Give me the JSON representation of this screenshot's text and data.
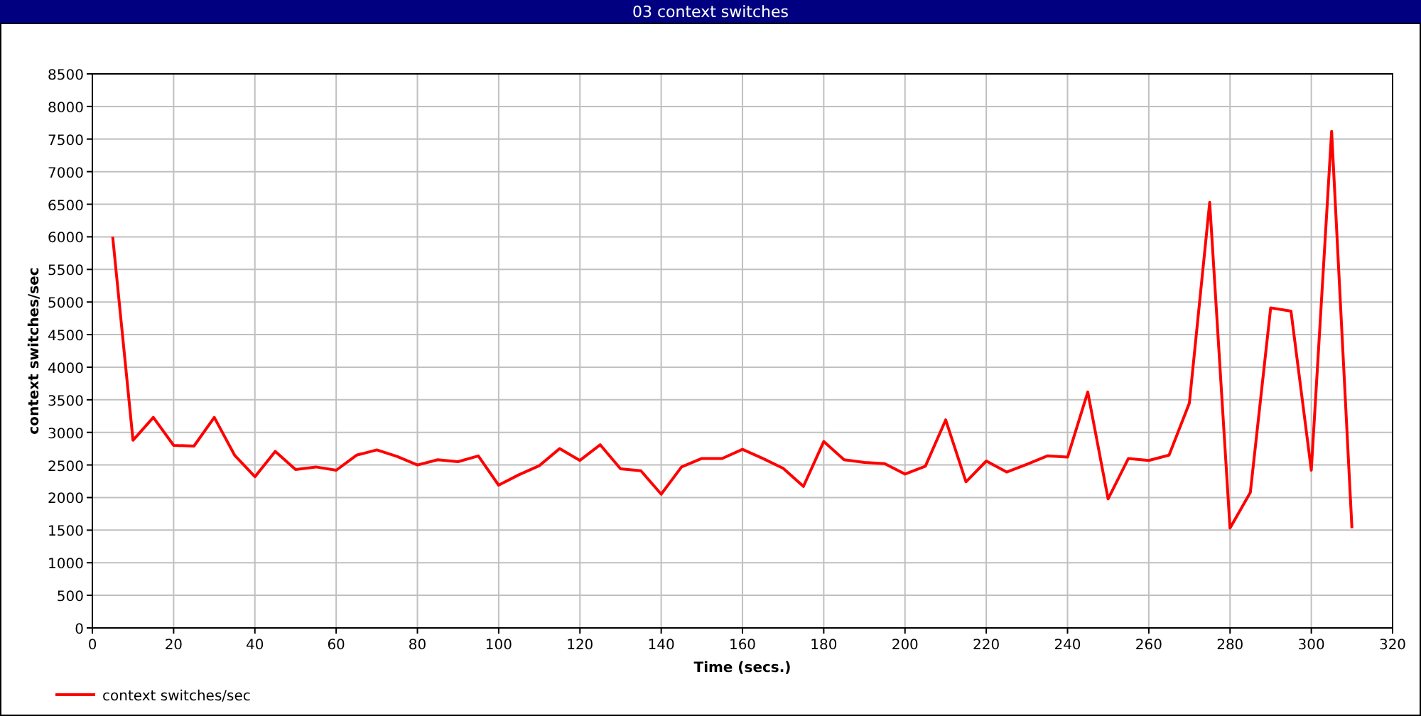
{
  "window": {
    "title": "03 context switches"
  },
  "chart": {
    "chart_data": {
      "type": "line",
      "xlabel": "Time (secs.)",
      "ylabel": "context switches/sec",
      "x": [
        5,
        10,
        15,
        20,
        25,
        30,
        35,
        40,
        45,
        50,
        55,
        60,
        65,
        70,
        75,
        80,
        85,
        90,
        95,
        100,
        105,
        110,
        115,
        120,
        125,
        130,
        135,
        140,
        145,
        150,
        155,
        160,
        165,
        170,
        175,
        180,
        185,
        190,
        195,
        200,
        205,
        210,
        215,
        220,
        225,
        230,
        235,
        240,
        245,
        250,
        255,
        260,
        265,
        270,
        275,
        280,
        285,
        290,
        295,
        300,
        305,
        310
      ],
      "series": [
        {
          "name": "context switches/sec",
          "color": "#ff0000",
          "values": [
            6000,
            2880,
            3230,
            2800,
            2790,
            3230,
            2650,
            2320,
            2710,
            2430,
            2470,
            2420,
            2650,
            2730,
            2630,
            2500,
            2580,
            2550,
            2640,
            2190,
            2350,
            2490,
            2750,
            2570,
            2810,
            2440,
            2410,
            2050,
            2470,
            2600,
            2600,
            2740,
            2600,
            2450,
            2170,
            2860,
            2580,
            2540,
            2520,
            2360,
            2480,
            3190,
            2240,
            2560,
            2390,
            2510,
            2640,
            2620,
            3620,
            1980,
            2600,
            2570,
            2650,
            3450,
            6530,
            1530,
            2080,
            4910,
            4860,
            2420,
            7620,
            1530
          ]
        }
      ],
      "grid": true,
      "xlim": [
        0,
        320
      ],
      "ylim": [
        0,
        8500
      ],
      "xticks": [
        0,
        20,
        40,
        60,
        80,
        100,
        120,
        140,
        160,
        180,
        200,
        220,
        240,
        260,
        280,
        300,
        320
      ],
      "yticks": [
        0,
        500,
        1000,
        1500,
        2000,
        2500,
        3000,
        3500,
        4000,
        4500,
        5000,
        5500,
        6000,
        6500,
        7000,
        7500,
        8000,
        8500
      ]
    }
  }
}
